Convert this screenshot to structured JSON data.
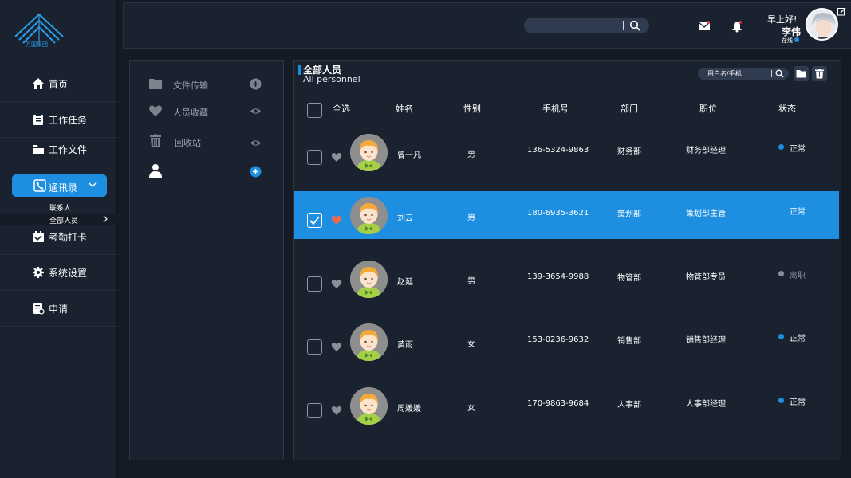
{
  "brand": {
    "name": "万国集团",
    "color": "#1e8fe0"
  },
  "sidebar": {
    "items": [
      {
        "label": "首页",
        "icon": "home-icon"
      },
      {
        "label": "工作任务",
        "icon": "task-icon"
      },
      {
        "label": "工作文件",
        "icon": "folder-icon"
      },
      {
        "label": "通讯录",
        "icon": "contacts-icon",
        "active": true
      },
      {
        "label": "考勤打卡",
        "icon": "calendar-check-icon"
      },
      {
        "label": "系统设置",
        "icon": "gear-icon"
      },
      {
        "label": "申请",
        "icon": "application-icon"
      }
    ],
    "sub_items": [
      {
        "label": "联系人"
      },
      {
        "label": "全部人员",
        "active": true
      }
    ]
  },
  "header": {
    "greeting": "早上好!",
    "user_name": "李伟",
    "user_status": "在线"
  },
  "left_panel": {
    "items": [
      {
        "label": "文件传输",
        "icon": "folder-icon",
        "action": "plus-circle-icon"
      },
      {
        "label": "人员收藏",
        "icon": "heart-icon",
        "action": "eye-icon"
      },
      {
        "label": "回收站",
        "icon": "trash-icon",
        "action": "eye-icon"
      },
      {
        "label": "",
        "icon": "user-icon",
        "action": "plus-circle-icon"
      }
    ]
  },
  "table": {
    "title": "全部人员",
    "subtitle": "All personnel",
    "search_placeholder": "用户名/手机",
    "headers": {
      "select_all": "全选",
      "name": "姓名",
      "gender": "性别",
      "phone": "手机号",
      "dept": "部门",
      "position": "职位",
      "status": "状态"
    },
    "rows": [
      {
        "name": "曾一凡",
        "gender": "男",
        "phone": "136-5324-9863",
        "dept": "财务部",
        "position": "财务部经理",
        "status": "正常",
        "favorite": false,
        "selected": false
      },
      {
        "name": "刘云",
        "gender": "男",
        "phone": "180-6935-3621",
        "dept": "策划部",
        "position": "策划部主管",
        "status": "正常",
        "favorite": true,
        "selected": true
      },
      {
        "name": "赵延",
        "gender": "男",
        "phone": "139-3654-9988",
        "dept": "物管部",
        "position": "物管部专员",
        "status": "离职",
        "favorite": false,
        "selected": false
      },
      {
        "name": "黄雨",
        "gender": "女",
        "phone": "153-0236-9632",
        "dept": "销售部",
        "position": "销售部经理",
        "status": "正常",
        "favorite": false,
        "selected": false
      },
      {
        "name": "周媛媛",
        "gender": "女",
        "phone": "170-9863-9684",
        "dept": "人事部",
        "position": "人事部经理",
        "status": "正常",
        "favorite": false,
        "selected": false
      }
    ]
  },
  "colors": {
    "accent": "#1e8fe0",
    "status_normal": "#1e8fe0",
    "status_left": "#8a8f97",
    "favorite": "#f06a4f"
  }
}
